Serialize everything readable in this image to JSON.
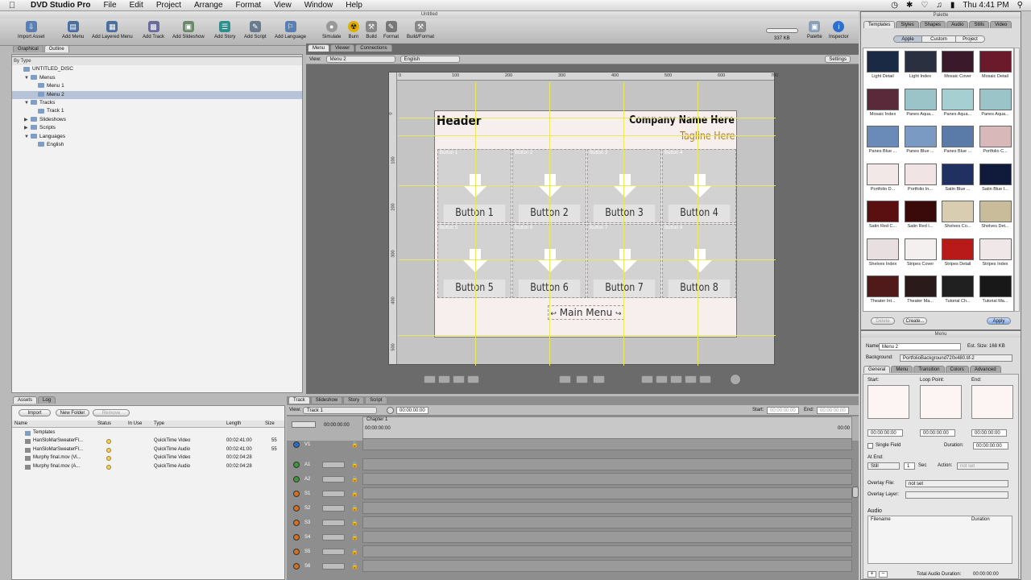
{
  "menubar": {
    "app_name": "DVD Studio Pro",
    "items": [
      "File",
      "Edit",
      "Project",
      "Arrange",
      "Format",
      "View",
      "Window",
      "Help"
    ],
    "clock": "Thu 4:41 PM"
  },
  "window": {
    "title": "Untitled"
  },
  "toolbar": {
    "left": [
      "Import Asset",
      "Add Menu",
      "Add Layered Menu",
      "Add Track",
      "Add Slideshow",
      "Add Story",
      "Add Script",
      "Add Language"
    ],
    "center": [
      "Simulate",
      "Burn",
      "Build",
      "Format",
      "Build/Format"
    ],
    "size": "337 KB",
    "right": [
      "Palette",
      "Inspector"
    ]
  },
  "outline": {
    "tabs": [
      "Graphical",
      "Outline"
    ],
    "header": "By Type",
    "rows": [
      {
        "label": "UNTITLED_DISC",
        "indent": 0,
        "tri": ""
      },
      {
        "label": "Menus",
        "indent": 1,
        "tri": "▼"
      },
      {
        "label": "Menu 1",
        "indent": 2,
        "tri": ""
      },
      {
        "label": "Menu 2",
        "indent": 2,
        "tri": "",
        "selected": true
      },
      {
        "label": "Tracks",
        "indent": 1,
        "tri": "▼"
      },
      {
        "label": "Track 1",
        "indent": 2,
        "tri": ""
      },
      {
        "label": "Slideshows",
        "indent": 1,
        "tri": "▶"
      },
      {
        "label": "Scripts",
        "indent": 1,
        "tri": "▶"
      },
      {
        "label": "Languages",
        "indent": 1,
        "tri": "▼"
      },
      {
        "label": "English",
        "indent": 2,
        "tri": ""
      }
    ]
  },
  "viewer": {
    "tabs": [
      "Menu",
      "Viewer",
      "Connections"
    ],
    "view_label": "View:",
    "view_value": "Menu 2",
    "language": "English",
    "settings": "Settings",
    "ruler": [
      "0",
      "100",
      "200",
      "300",
      "400",
      "500",
      "600",
      "700"
    ],
    "ruler_v": [
      "0",
      "100",
      "200",
      "300",
      "400",
      "500"
    ]
  },
  "menu_canvas": {
    "header": "Header",
    "company": "Company Name Here",
    "tagline": "Tagline Here",
    "main_menu": "Main Menu",
    "buttons": [
      {
        "id": "Button 1",
        "caption": "Button 1"
      },
      {
        "id": "Button 2",
        "caption": "Button 2"
      },
      {
        "id": "Button 3",
        "caption": "Button 3"
      },
      {
        "id": "Button 4",
        "caption": "Button 4"
      },
      {
        "id": "Button 5",
        "caption": "Button 5"
      },
      {
        "id": "Button 6",
        "caption": "Button 6"
      },
      {
        "id": "Button 7",
        "caption": "Button 7"
      },
      {
        "id": "Button 8",
        "caption": "Button 8"
      }
    ]
  },
  "assets": {
    "tabs": [
      "Assets",
      "Log"
    ],
    "buttons": [
      "Import",
      "New Folder",
      "Remove"
    ],
    "columns": [
      "Name",
      "Status",
      "In Use",
      "Type",
      "Length",
      "Size"
    ],
    "rows": [
      {
        "name": "Templates",
        "type": "",
        "length": "",
        "size": ""
      },
      {
        "name": "HanSloMarSweaterFl...",
        "type": "QuickTime Video",
        "length": "00:02:41:00",
        "size": "55"
      },
      {
        "name": "HanSloMarSweaterFl...",
        "type": "QuickTime Audio",
        "length": "00:02:41:00",
        "size": "55"
      },
      {
        "name": "Murphy final.mov (Vi...",
        "type": "QuickTime Video",
        "length": "00:02:04:28",
        "size": ""
      },
      {
        "name": "Murphy final.mov (A...",
        "type": "QuickTime Audio",
        "length": "00:02:04:28",
        "size": ""
      }
    ]
  },
  "timeline": {
    "tabs": [
      "Track",
      "Slideshow",
      "Story",
      "Script"
    ],
    "view_label": "View:",
    "view_value": "Track 1",
    "timecode": "00:00:00:00",
    "start_label": "Start:",
    "start_value": "00:00:00:00",
    "end_label": "End:",
    "end_value": "00:00:00:00",
    "chapter": "Chapter 1",
    "ruler_tc": "00:00:00:00",
    "ruler_end": "00:00",
    "tracks": [
      "V1",
      "A1",
      "A2",
      "S1",
      "S2",
      "S3",
      "S4",
      "S5",
      "S6"
    ]
  },
  "palette": {
    "title": "Palette",
    "tabs": [
      "Templates",
      "Styles",
      "Shapes",
      "Audio",
      "Stills",
      "Video"
    ],
    "subtabs": [
      "Apple",
      "Custom",
      "Project"
    ],
    "templates": [
      "Light Detail",
      "Light Index",
      "Mosaic Cover",
      "Mosaic Detail",
      "Mosaic Index",
      "Panes Aqua...",
      "Panes Aqua...",
      "Panes Aqua...",
      "Panes Blue ...",
      "Panes Blue ...",
      "Panes Blue ...",
      "Portfolio C...",
      "Portfolio D...",
      "Portfolio In...",
      "Satin Blue ...",
      "Satin Blue I...",
      "Satin Red C...",
      "Satin Red I...",
      "Shelves Co...",
      "Shelves Det...",
      "Shelves Index",
      "Stripes Cover",
      "Stripes Detail",
      "Stripes Index",
      "Theater Int...",
      "Theater Ma...",
      "Tutorial Ch...",
      "Tutorial Ma..."
    ],
    "buttons": [
      "Delete",
      "Create...",
      "Apply"
    ]
  },
  "inspector": {
    "title": "Menu",
    "name_label": "Name:",
    "name_value": "Menu 2",
    "est_size": "Est. Size: 168 KB",
    "bg_label": "Background:",
    "bg_value": "PortfolioBackground720x480.tif-2",
    "tabs": [
      "General",
      "Menu",
      "Transition",
      "Colors",
      "Advanced"
    ],
    "start": "Start:",
    "loop": "Loop Point:",
    "end": "End:",
    "tc": "00:00:00:00",
    "single_field": "Single Field",
    "duration_label": "Duration:",
    "at_end": "At End:",
    "still": "Still",
    "sec_value": "1",
    "sec": "Sec",
    "action_label": "Action:",
    "action_value": "not set",
    "overlay_file_label": "Overlay File:",
    "overlay_file_value": "not set",
    "overlay_layer_label": "Overlay Layer:",
    "audio": "Audio",
    "audio_cols": [
      "Filename",
      "Duration"
    ],
    "total_audio": "Total Audio Duration:",
    "total_value": "00:00:00:00"
  },
  "colors": {
    "accent": "#e8e85a",
    "canvas": "#f7eeee",
    "selection": "#b7c4d8"
  }
}
